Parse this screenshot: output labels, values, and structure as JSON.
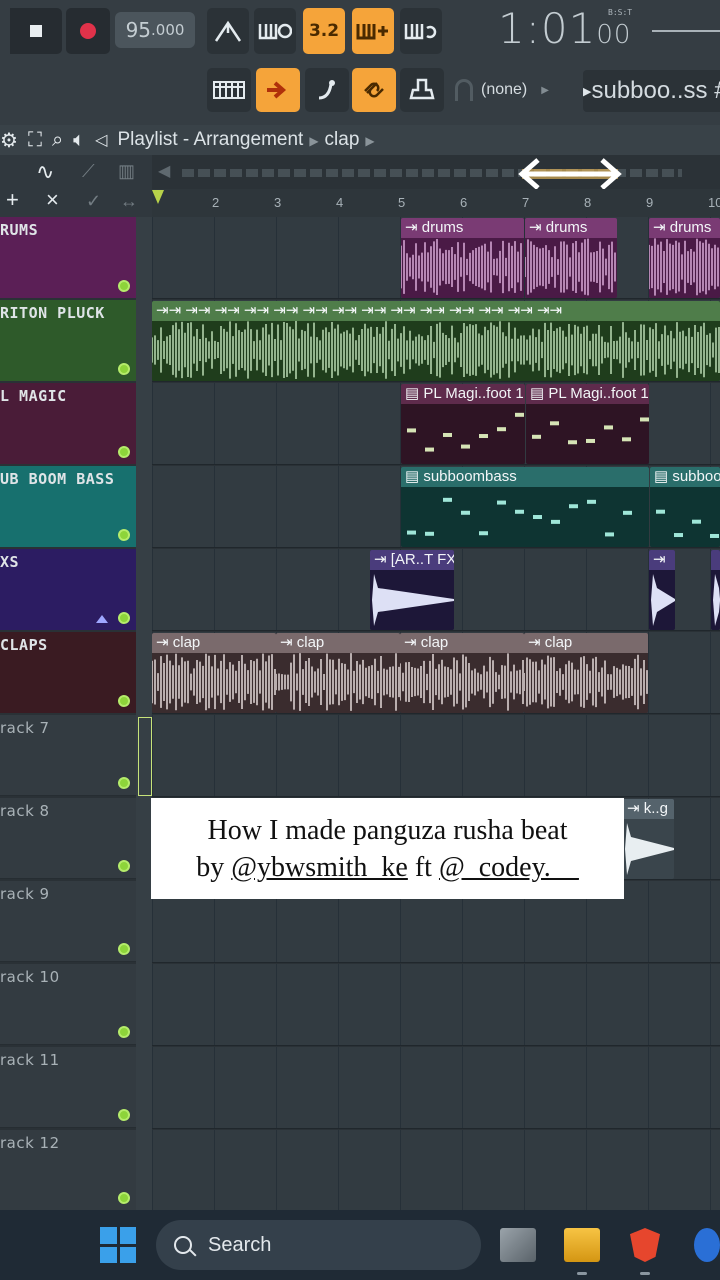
{
  "toolbar": {
    "tempo_int": "95",
    "tempo_dec": ".000",
    "pattern_label": "3.2",
    "time": "1:01",
    "time_small": "00",
    "time_label": "B:S:T",
    "pattern_select": "(none)",
    "song_select": "subboo..ss #"
  },
  "playlist": {
    "title": "Playlist - Arrangement",
    "breadcrumb": "clap",
    "ruler_numbers": [
      "2",
      "3",
      "4",
      "5",
      "6",
      "7",
      "8",
      "9",
      "10"
    ]
  },
  "tracks": [
    {
      "name": "RUMS",
      "color": "#5b1f56",
      "led": true
    },
    {
      "name": "RITON PLUCK",
      "color": "#2e5a2a",
      "led": true
    },
    {
      "name": "L MAGIC",
      "color": "#4a1c38",
      "led": true
    },
    {
      "name": "UB BOOM BASS",
      "color": "#17706e",
      "led": true
    },
    {
      "name": "XS",
      "color": "#2c1c62",
      "led": true
    },
    {
      "name": "CLAPS",
      "color": "#3a1b22",
      "led": true
    },
    {
      "name": "rack 7",
      "color": "#333b41",
      "led": true
    },
    {
      "name": "rack 8",
      "color": "#333b41",
      "led": true
    },
    {
      "name": "rack 9",
      "color": "#333b41",
      "led": true
    },
    {
      "name": "rack 10",
      "color": "#333b41",
      "led": true
    },
    {
      "name": "rack 11",
      "color": "#333b41",
      "led": true
    },
    {
      "name": "rack 12",
      "color": "#333b41",
      "led": true
    }
  ],
  "clips": {
    "drums": "drums",
    "pl_magic": "PL Magi..foot 1",
    "subboombass": "subboombass",
    "subboo_partial": "subboo",
    "art_fx": "[AR..T FX",
    "clap": "clap",
    "kg": "k..g"
  },
  "caption": {
    "line1": "How I made panguza rusha beat",
    "line2_prefix": "by ",
    "handle1": "@ybwsmith_ke",
    "mid": " ft ",
    "handle2": "@_codey.__"
  },
  "taskbar": {
    "search_placeholder": "Search"
  },
  "colors": {
    "accent_orange": "#f5a43a",
    "led_green": "#8dd43a",
    "playhead": "#b8d24a"
  }
}
